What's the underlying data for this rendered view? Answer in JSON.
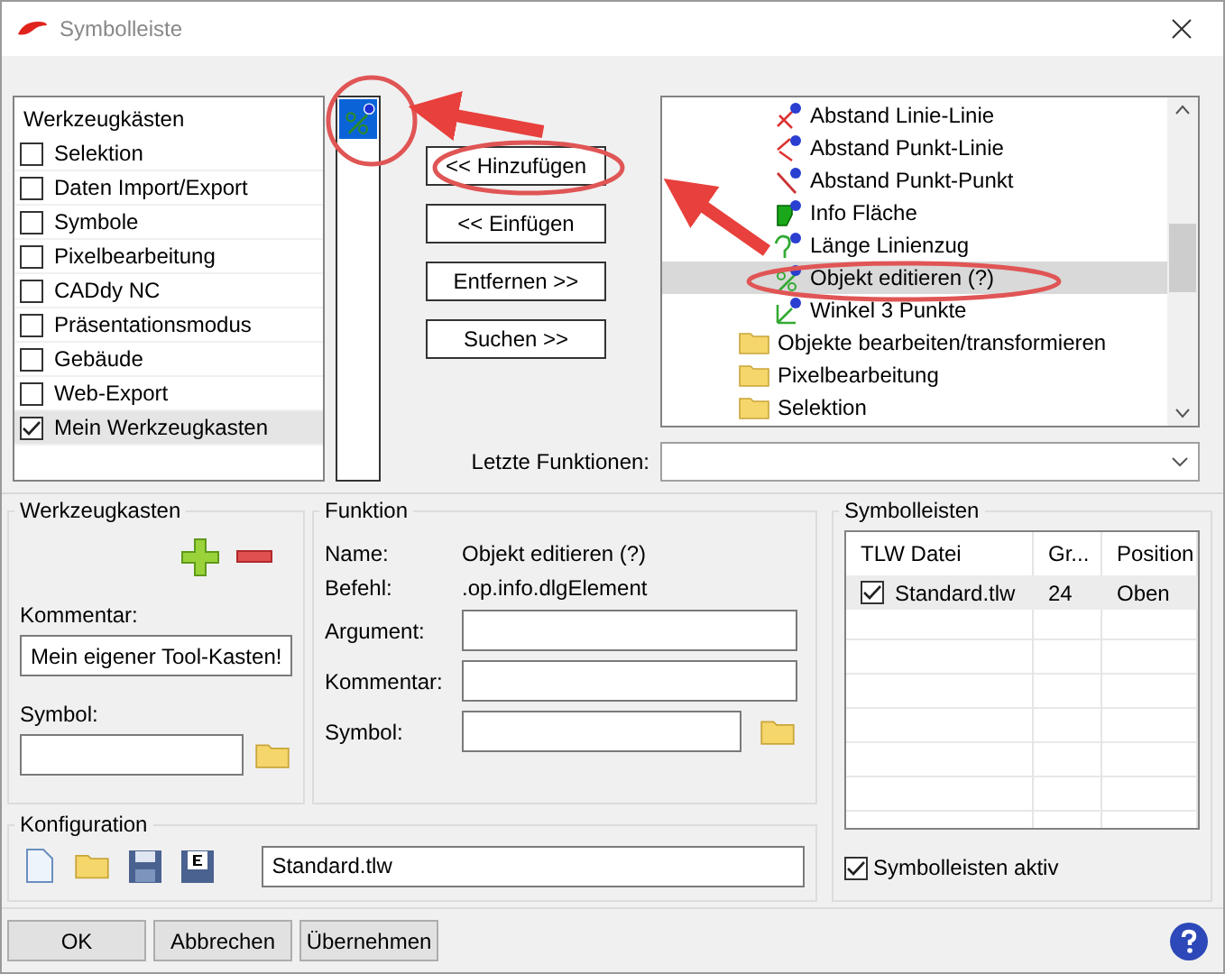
{
  "window": {
    "title": "Symbolleiste"
  },
  "toolbox_list": {
    "header": "Werkzeugkästen",
    "items": [
      {
        "label": "Selektion",
        "checked": false,
        "selected": false
      },
      {
        "label": "Daten Import/Export",
        "checked": false,
        "selected": false
      },
      {
        "label": "Symbole",
        "checked": false,
        "selected": false
      },
      {
        "label": "Pixelbearbeitung",
        "checked": false,
        "selected": false
      },
      {
        "label": "CADdy NC",
        "checked": false,
        "selected": false
      },
      {
        "label": "Präsentationsmodus",
        "checked": false,
        "selected": false
      },
      {
        "label": "Gebäude",
        "checked": false,
        "selected": false
      },
      {
        "label": "Web-Export",
        "checked": false,
        "selected": false
      },
      {
        "label": "Mein Werkzeugkasten",
        "checked": true,
        "selected": true
      }
    ]
  },
  "icon_strip": {
    "items": [
      {
        "selected": true
      }
    ]
  },
  "buttons": [
    "<< Hinzufügen",
    "<< Einfügen",
    "Entfernen >>",
    "Suchen >>"
  ],
  "function_tree": {
    "items": [
      {
        "label": "Abstand Linie-Linie",
        "kind": "function",
        "selected": false
      },
      {
        "label": "Abstand Punkt-Linie",
        "kind": "function",
        "selected": false
      },
      {
        "label": "Abstand Punkt-Punkt",
        "kind": "function",
        "selected": false
      },
      {
        "label": "Info Fläche",
        "kind": "function",
        "selected": false
      },
      {
        "label": "Länge Linienzug",
        "kind": "function",
        "selected": false
      },
      {
        "label": "Objekt editieren (?)",
        "kind": "function",
        "selected": true
      },
      {
        "label": "Winkel 3 Punkte",
        "kind": "function",
        "selected": false
      },
      {
        "label": "Objekte bearbeiten/transformieren",
        "kind": "folder",
        "selected": false
      },
      {
        "label": "Pixelbearbeitung",
        "kind": "folder",
        "selected": false
      },
      {
        "label": "Selektion",
        "kind": "folder",
        "selected": false
      }
    ]
  },
  "recent_functions": {
    "label": "Letzte Funktionen:"
  },
  "toolbox_group": {
    "title": "Werkzeugkasten",
    "comment_label": "Kommentar:",
    "comment_value": "Mein eigener Tool-Kasten!",
    "symbol_label": "Symbol:"
  },
  "function_group": {
    "title": "Funktion",
    "name_label": "Name:",
    "name_value": "Objekt editieren (?)",
    "command_label": "Befehl:",
    "command_value": ".op.info.dlgElement",
    "argument_label": "Argument:",
    "comment_label": "Kommentar:",
    "symbol_label": "Symbol:"
  },
  "configuration_group": {
    "title": "Konfiguration",
    "file_value": "Standard.tlw"
  },
  "toolbars_group": {
    "title": "Symbolleisten",
    "columns": [
      "TLW Datei",
      "Gr...",
      "Position"
    ],
    "rows": [
      {
        "checked": true,
        "selected": true,
        "cells": [
          "Standard.tlw",
          "24",
          "Oben"
        ]
      }
    ],
    "active": {
      "label": "Symbolleisten aktiv",
      "checked": true
    }
  },
  "footer_buttons": [
    "OK",
    "Abbrechen",
    "Übernehmen"
  ]
}
